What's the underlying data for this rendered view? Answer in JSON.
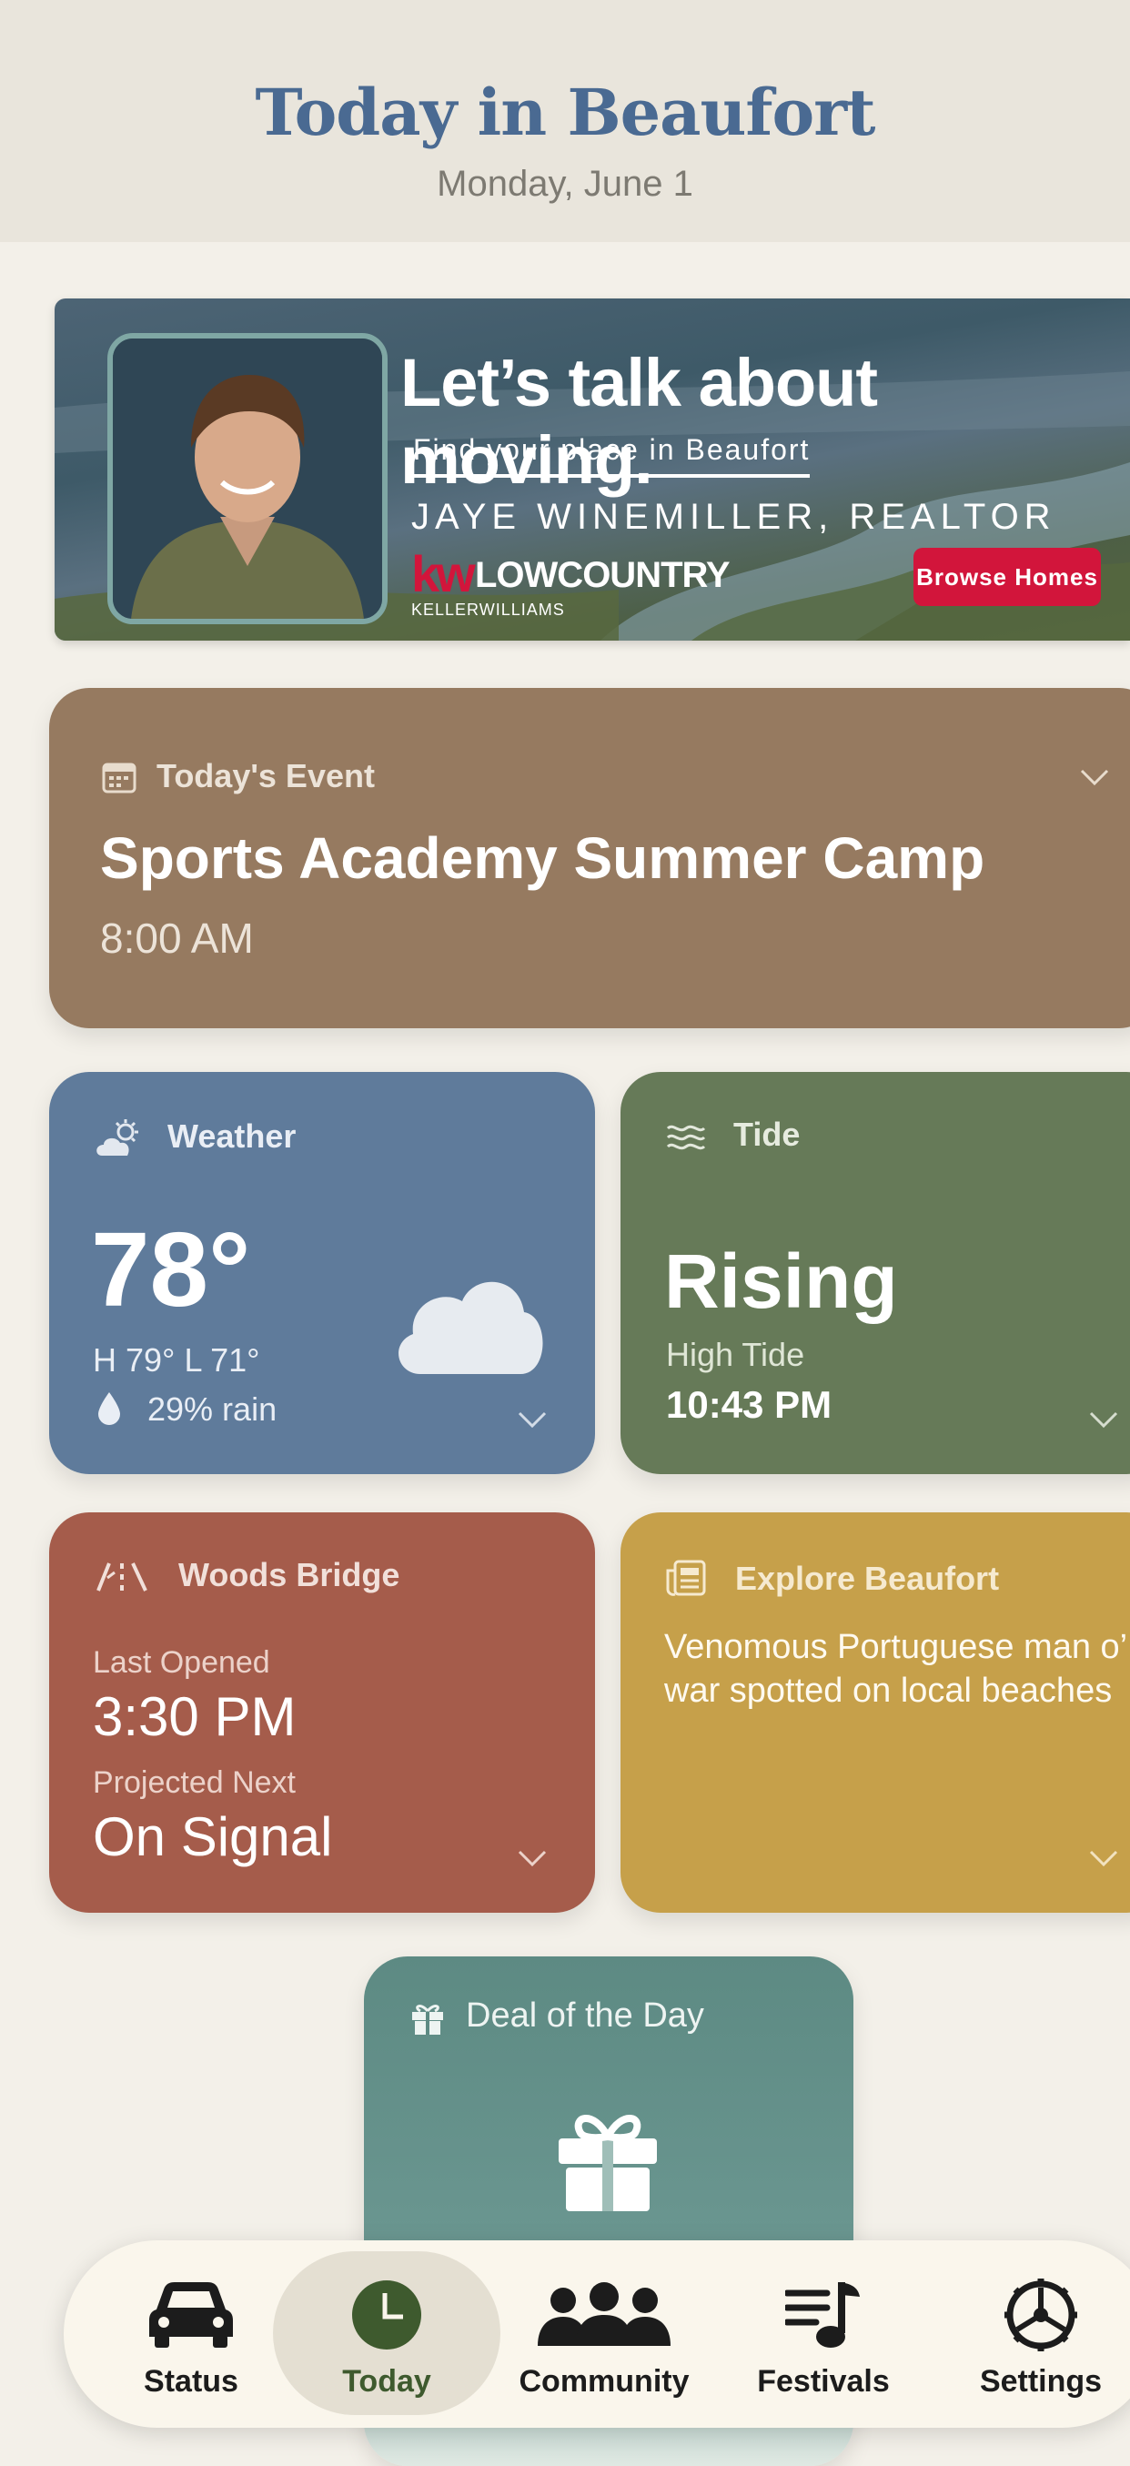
{
  "header": {
    "title": "Today in Beaufort",
    "date": "Monday, June 1"
  },
  "ad": {
    "headline": "Let’s talk about moving.",
    "subheadline": "Find your place in Beaufort",
    "agent": "JAYE WINEMILLER, REALTOR",
    "logo_kw": "kw",
    "logo_brand": "LOWCOUNTRY",
    "logo_company": "KELLERWILLIAMS",
    "button": "Browse Homes"
  },
  "event": {
    "label": "Today's Event",
    "title": "Sports Academy Summer Camp",
    "time": "8:00 AM"
  },
  "weather": {
    "label": "Weather",
    "temp": "78°",
    "hilo": "H 79°  L 71°",
    "rain": "29% rain",
    "icon": "cloud-icon"
  },
  "tide": {
    "label": "Tide",
    "status": "Rising",
    "sub_label": "High Tide",
    "time": "10:43 PM"
  },
  "bridge": {
    "label": "Woods Bridge",
    "last_label": "Last Opened",
    "last_value": "3:30 PM",
    "next_label": "Projected Next",
    "next_value": "On Signal"
  },
  "explore": {
    "label": "Explore Beaufort",
    "headline": "Venomous Portuguese man o’ war spotted on local beaches"
  },
  "deal": {
    "label": "Deal of the Day"
  },
  "nav": {
    "items": [
      {
        "label": "Status",
        "icon": "car-icon"
      },
      {
        "label": "Today",
        "icon": "clock-icon"
      },
      {
        "label": "Community",
        "icon": "people-icon"
      },
      {
        "label": "Festivals",
        "icon": "music-list-icon"
      },
      {
        "label": "Settings",
        "icon": "wheel-icon"
      }
    ],
    "active": "Today"
  },
  "colors": {
    "title": "#4a6a92",
    "event": "#967a60",
    "weather": "#5f7b9b",
    "tide": "#667a58",
    "bridge": "#a55c4b",
    "explore": "#c6a04a",
    "deal": "#5d8a83",
    "ad_button": "#d2153b"
  }
}
